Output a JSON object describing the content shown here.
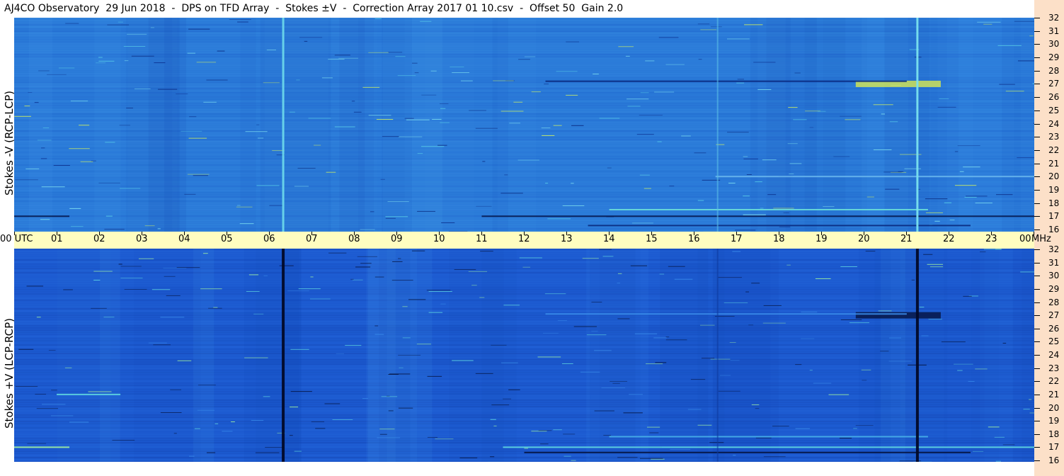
{
  "title": "AJ4CO Observatory  29 Jun 2018  -  DPS on TFD Array  -  Stokes ±V  -  Correction Array 2017 01 10.csv  -  Offset 50  Gain 2.0",
  "chart_data": [
    {
      "type": "heatmap",
      "ylabel": "Stokes -V  (RCP-LCP)",
      "ylim": [
        16,
        32
      ],
      "y_ticks": [
        "32",
        "31",
        "30",
        "29",
        "28",
        "27",
        "26",
        "25",
        "24",
        "23",
        "22",
        "21",
        "20",
        "19",
        "18",
        "17",
        "16"
      ],
      "x_range_utc": [
        0,
        24
      ],
      "base_color": "#2a7ad8",
      "vertical_features": [
        {
          "time_utc": 6.33,
          "style": "bright",
          "color": "#6ad6ea"
        },
        {
          "time_utc": 16.55,
          "style": "faint",
          "color": "#5cc0e6"
        },
        {
          "time_utc": 21.25,
          "style": "bright",
          "color": "#7ae2ee"
        }
      ],
      "horizontal_features": [
        {
          "freq_mhz": 27.0,
          "from_utc": 19.8,
          "to_utc": 21.8,
          "color": "#d8e850",
          "label": "bright RFI band"
        },
        {
          "freq_mhz": 27.2,
          "from_utc": 12.5,
          "to_utc": 21.0,
          "color": "#0a2a80"
        },
        {
          "freq_mhz": 17.0,
          "from_utc": 0.0,
          "to_utc": 1.3,
          "color": "#061a50"
        },
        {
          "freq_mhz": 17.0,
          "from_utc": 11.0,
          "to_utc": 24.0,
          "color": "#061a50"
        },
        {
          "freq_mhz": 17.5,
          "from_utc": 14.0,
          "to_utc": 21.5,
          "color": "#6ce0d8"
        },
        {
          "freq_mhz": 16.3,
          "from_utc": 13.5,
          "to_utc": 22.5,
          "color": "#0a2a80"
        },
        {
          "freq_mhz": 20.0,
          "from_utc": 16.5,
          "to_utc": 24.0,
          "color": "#6ab8ee"
        }
      ]
    },
    {
      "type": "heatmap",
      "ylabel": "Stokes +V  (LCP-RCP)",
      "ylim": [
        16,
        32
      ],
      "y_ticks": [
        "32",
        "31",
        "30",
        "29",
        "28",
        "27",
        "26",
        "25",
        "24",
        "23",
        "22",
        "21",
        "20",
        "19",
        "18",
        "17",
        "16"
      ],
      "x_range_utc": [
        0,
        24
      ],
      "base_color": "#1c5ad0",
      "vertical_features": [
        {
          "time_utc": 6.33,
          "style": "dark",
          "color": "#020a28"
        },
        {
          "time_utc": 16.55,
          "style": "faint-dark",
          "color": "#0e3a9e"
        },
        {
          "time_utc": 21.25,
          "style": "dark",
          "color": "#020a28"
        }
      ],
      "horizontal_features": [
        {
          "freq_mhz": 27.0,
          "from_utc": 19.8,
          "to_utc": 21.8,
          "color": "#061440",
          "label": "dark RFI band"
        },
        {
          "freq_mhz": 27.1,
          "from_utc": 12.5,
          "to_utc": 21.0,
          "color": "#3a8cea"
        },
        {
          "freq_mhz": 17.0,
          "from_utc": 0.0,
          "to_utc": 1.3,
          "color": "#a0f0a0"
        },
        {
          "freq_mhz": 17.0,
          "from_utc": 11.5,
          "to_utc": 24.0,
          "color": "#60d8e0"
        },
        {
          "freq_mhz": 16.6,
          "from_utc": 12.0,
          "to_utc": 22.5,
          "color": "#061440"
        },
        {
          "freq_mhz": 17.8,
          "from_utc": 14.0,
          "to_utc": 21.5,
          "color": "#48b0e8"
        },
        {
          "freq_mhz": 21.0,
          "from_utc": 1.0,
          "to_utc": 2.5,
          "color": "#60d8e0"
        }
      ]
    }
  ],
  "x_axis": {
    "tick_labels": [
      "00  UTC",
      "01",
      "02",
      "03",
      "04",
      "05",
      "06",
      "07",
      "08",
      "09",
      "10",
      "11",
      "12",
      "13",
      "14",
      "15",
      "16",
      "17",
      "18",
      "19",
      "20",
      "21",
      "22",
      "23",
      "00"
    ],
    "unit_label": "MHz"
  }
}
